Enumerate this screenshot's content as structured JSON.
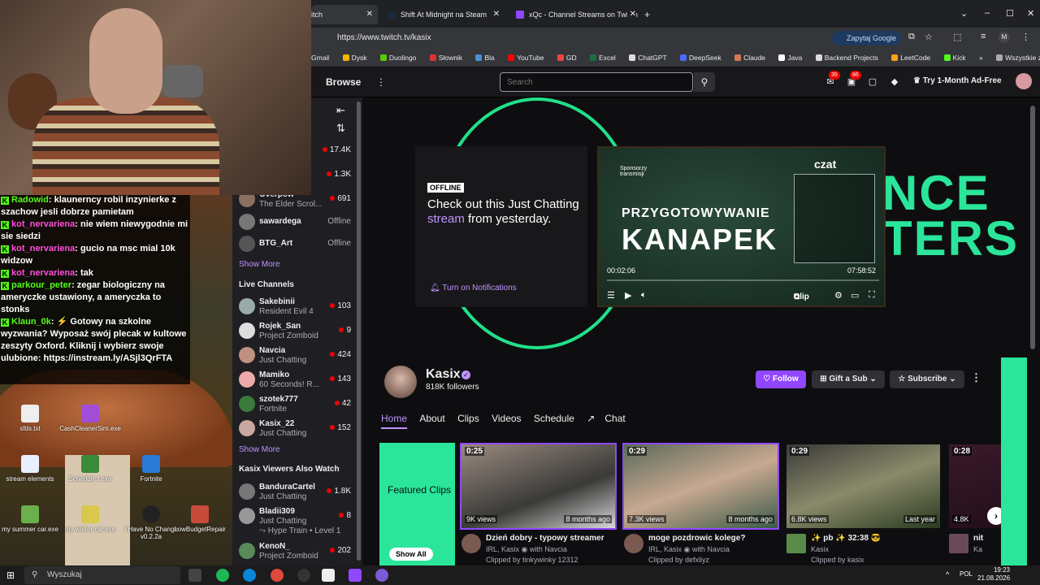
{
  "chat": [
    {
      "user": "Radowid",
      "text": "klaunerncy robil inzynierke z szachow jesli dobrze pamietam"
    },
    {
      "user": "kot_nervariena",
      "text": "nie wiem niewygodnie mi sie siedzi"
    },
    {
      "user": "kot_nervariena",
      "text": "gucio na msc mial 10k widzow"
    },
    {
      "user": "kot_nervariena",
      "text": "tak"
    },
    {
      "user": "parkour_peter",
      "text": "zegar biologiczny na ameryczke ustawiony, a ameryczka to stonks"
    },
    {
      "user": "Klaun_0k",
      "text": "⚡ Gotowy na szkolne wyzwania? Wyposaż swój plecak w kultowe zeszyty Oxford. Kliknij i wybierz swoje ulubione: https://instream.ly/ASjl3QrFTA"
    }
  ],
  "desktop_icons": [
    "sfds.txt",
    "CashCleanerSim.exe",
    "stream elements",
    "Schedule I.exe",
    "Fortnite",
    "my summer car.exe",
    "my winter car.exe",
    "I Have No Change v0.2.2a",
    "LowBudgetRepair"
  ],
  "browser": {
    "tabs": [
      "itch",
      "Shift At Midnight na Steam",
      "xQc - Channel Streams on Twitch"
    ],
    "url": "https://www.twitch.tv/kasix",
    "google_btn": "Zapytaj Google",
    "bookmarks": [
      "Gmail",
      "Dysk",
      "Duolingo",
      "Słownik",
      "Bla",
      "YouTube",
      "GD",
      "Excel",
      "ChatGPT",
      "DeepSeek",
      "Claude",
      "Java",
      "Backend Projects",
      "LeetCode",
      "Kick"
    ],
    "bookmarks_more": "»",
    "all_bookmarks": "Wszystkie zakładki"
  },
  "header": {
    "browse": "Browse",
    "search_placeholder": "Search",
    "notif1": "35",
    "notif2": "86",
    "adfree": "Try 1-Month Ad-Free"
  },
  "sidenav": {
    "top_rows": [
      {
        "v": "17.4K"
      },
      {
        "v": "1.3K"
      }
    ],
    "followed": [
      {
        "name": "Overpow",
        "game": "The Elder Scrol...",
        "viewers": "691",
        "live": true
      },
      {
        "name": "sawardega",
        "game": "",
        "viewers": "Offline",
        "live": false
      },
      {
        "name": "BTG_Art",
        "game": "",
        "viewers": "Offline",
        "live": false
      }
    ],
    "show_more": "Show More",
    "live_channels_title": "Live Channels",
    "live": [
      {
        "name": "Sakebinii",
        "game": "Resident Evil 4",
        "viewers": "103"
      },
      {
        "name": "Rojek_San",
        "game": "Project Zomboid",
        "viewers": "9"
      },
      {
        "name": "Navcia",
        "game": "Just Chatting",
        "viewers": "424"
      },
      {
        "name": "Mamiko",
        "game": "60 Seconds! R...",
        "viewers": "143"
      },
      {
        "name": "szotek777",
        "game": "Fortnite",
        "viewers": "42"
      },
      {
        "name": "Kasix_22",
        "game": "Just Chatting",
        "viewers": "152"
      }
    ],
    "show_more2": "Show More",
    "also_watch_title": "Kasix Viewers Also Watch",
    "also": [
      {
        "name": "BanduraCartel",
        "game": "Just Chatting",
        "viewers": "1.8K"
      },
      {
        "name": "Bladii309",
        "game": "Just Chatting",
        "viewers": "8",
        "extra": "Hype Train • Level 1"
      },
      {
        "name": "KenoN_",
        "game": "Project Zomboid",
        "viewers": "202"
      }
    ]
  },
  "banner": {
    "offline": "OFFLINE",
    "offline_text_a": "Check out this Just Chatting ",
    "offline_text_hl": "stream",
    "offline_text_b": " from yesterday.",
    "turn_on": "Turn on Notifications",
    "big1": "NCE",
    "big2": "TERS",
    "player": {
      "spons": "Sponsorzy transmisji",
      "title1": "PRZYGOTOWYWANIE",
      "title2": "KANAPEK",
      "czat": "czat",
      "time": "00:02:06",
      "duration": "07:58:52",
      "clip": "Clip"
    }
  },
  "channel": {
    "name": "Kasix",
    "followers": "818K followers",
    "follow": "Follow",
    "gift": "Gift a Sub",
    "subscribe": "Subscribe",
    "tabs": [
      "Home",
      "About",
      "Clips",
      "Videos",
      "Schedule",
      "Chat"
    ]
  },
  "clips": {
    "featured": "Featured Clips",
    "show_all": "Show All",
    "items": [
      {
        "len": "0:25",
        "views": "9K views",
        "ago": "8 months ago",
        "title": "Dzień dobry - typowy streamer",
        "by": "IRL, Kasix",
        "with": "with Navcia",
        "clipped": "Clipped by tinkywinky 12312"
      },
      {
        "len": "0:29",
        "views": "7.3K views",
        "ago": "8 months ago",
        "title": "moge pozdrowic kolege?",
        "by": "IRL, Kasix",
        "with": "with Navcia",
        "clipped": "Clipped by defxliyz"
      },
      {
        "len": "0:29",
        "views": "6.8K views",
        "ago": "Last year",
        "title": "✨ pb ✨ 32:38 😎",
        "by": "Kasix",
        "with": "",
        "clipped": "Clipped by kasix"
      },
      {
        "len": "0:28",
        "views": "4.8K",
        "ago": "",
        "title": "nit",
        "by": "Ka",
        "with": "",
        "clipped": ""
      }
    ]
  },
  "taskbar": {
    "search": "Wyszukaj",
    "lang": "POL",
    "time": "19:23",
    "date": "21.08.2026"
  },
  "colors": {
    "accent": "#9147ff",
    "green": "#2ae59a",
    "live": "#eb0400"
  }
}
